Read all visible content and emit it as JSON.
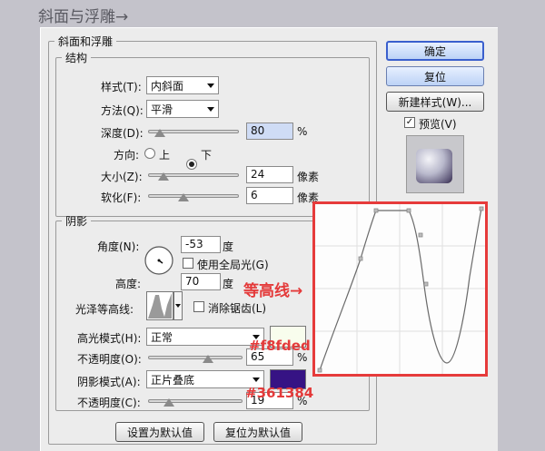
{
  "page_title": "斜面与浮雕→",
  "dialog": {
    "group_title": "斜面和浮雕",
    "structure": {
      "title": "结构",
      "style_label": "样式(T):",
      "style_value": "内斜面",
      "method_label": "方法(Q):",
      "method_value": "平滑",
      "depth_label": "深度(D):",
      "depth_value": "80",
      "depth_unit": "%",
      "depth_level": 0.08,
      "direction_label": "方向:",
      "dir_up": "上",
      "dir_down": "下",
      "direction_selected": "下",
      "size_label": "大小(Z):",
      "size_value": "24",
      "size_level": 0.12,
      "size_unit": "像素",
      "soften_label": "软化(F):",
      "soften_value": "6",
      "soften_level": 0.37,
      "soften_unit": "像素"
    },
    "shading": {
      "title": "阴影",
      "angle_label": "角度(N):",
      "angle_value": "-53",
      "angle_unit": "度",
      "global_light_label": "使用全局光(G)",
      "altitude_label": "高度:",
      "altitude_value": "70",
      "altitude_unit": "度",
      "gloss_contour_label": "光泽等高线:",
      "anti_alias_label": "消除锯齿(L)",
      "highlight_mode_label": "高光模式(H):",
      "highlight_mode_value": "正常",
      "highlight_color": "#f8fded",
      "highlight_opacity_label": "不透明度(O):",
      "highlight_opacity_value": "65",
      "highlight_opacity_level": 0.65,
      "shadow_mode_label": "阴影模式(A):",
      "shadow_mode_value": "正片叠底",
      "shadow_color": "#361384",
      "shadow_opacity_label": "不透明度(C):",
      "shadow_opacity_value": "19",
      "shadow_opacity_level": 0.19,
      "opacity_unit": "%"
    },
    "buttons": {
      "set_default": "设置为默认值",
      "reset_default": "复位为默认值",
      "ok": "确定",
      "reset": "复位",
      "new_style": "新建样式(W)...",
      "preview": "预览(V)"
    }
  },
  "annotations": {
    "contour_label": "等高线→",
    "highlight_hex": "#f8fded",
    "shadow_hex": "#361384"
  }
}
